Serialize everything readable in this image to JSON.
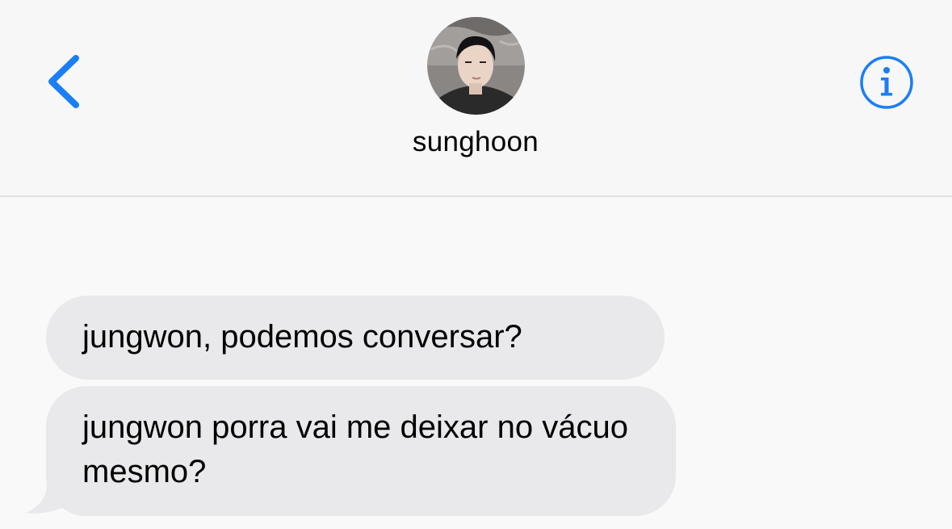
{
  "header": {
    "contact_name": "sunghoon",
    "back_icon": "chevron-left-icon",
    "info_icon": "info-circle-icon",
    "avatar": "contact-photo",
    "accent_color": "#1a7ef6"
  },
  "messages": [
    {
      "direction": "incoming",
      "text": "jungwon, podemos conversar?"
    },
    {
      "direction": "incoming",
      "text": "jungwon porra vai me deixar no vácuo mesmo?"
    }
  ],
  "colors": {
    "background": "#f9f9f9",
    "incoming_bubble": "#e9e9eb",
    "divider": "#e2e2e4"
  }
}
